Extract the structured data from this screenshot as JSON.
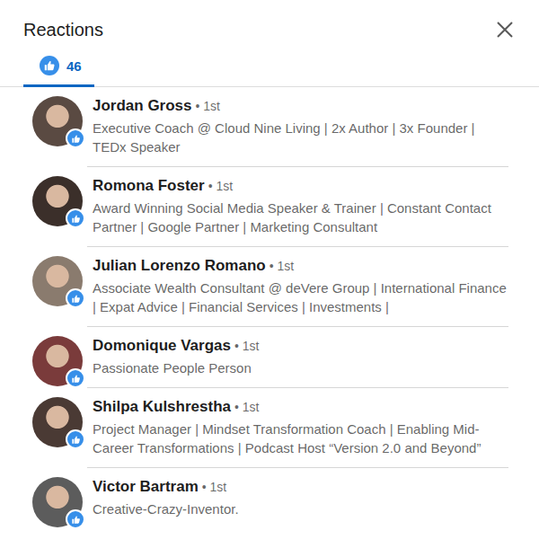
{
  "title": "Reactions",
  "tabs": [
    {
      "count": "46",
      "selected": true
    }
  ],
  "reactors": [
    {
      "name": "Jordan Gross",
      "degree": "• 1st",
      "headline": "Executive Coach @ Cloud Nine Living | 2x Author | 3x Founder | TEDx Speaker"
    },
    {
      "name": "Romona Foster",
      "degree": "• 1st",
      "headline": "Award Winning Social Media Speaker & Trainer | Constant Contact Partner | Google Partner | Marketing Consultant"
    },
    {
      "name": "Julian Lorenzo Romano",
      "degree": "• 1st",
      "headline": "Associate Wealth Consultant @ deVere Group | International Finance | Expat Advice | Financial Services | Investments |"
    },
    {
      "name": "Domonique Vargas",
      "degree": "• 1st",
      "headline": "Passionate People Person"
    },
    {
      "name": "Shilpa Kulshrestha",
      "degree": "• 1st",
      "headline": "Project Manager | Mindset Transformation Coach | Enabling Mid-Career Transformations | Podcast Host “Version 2.0 and Beyond”"
    },
    {
      "name": "Victor Bartram",
      "degree": "• 1st",
      "headline": "Creative-Crazy-Inventor."
    }
  ]
}
